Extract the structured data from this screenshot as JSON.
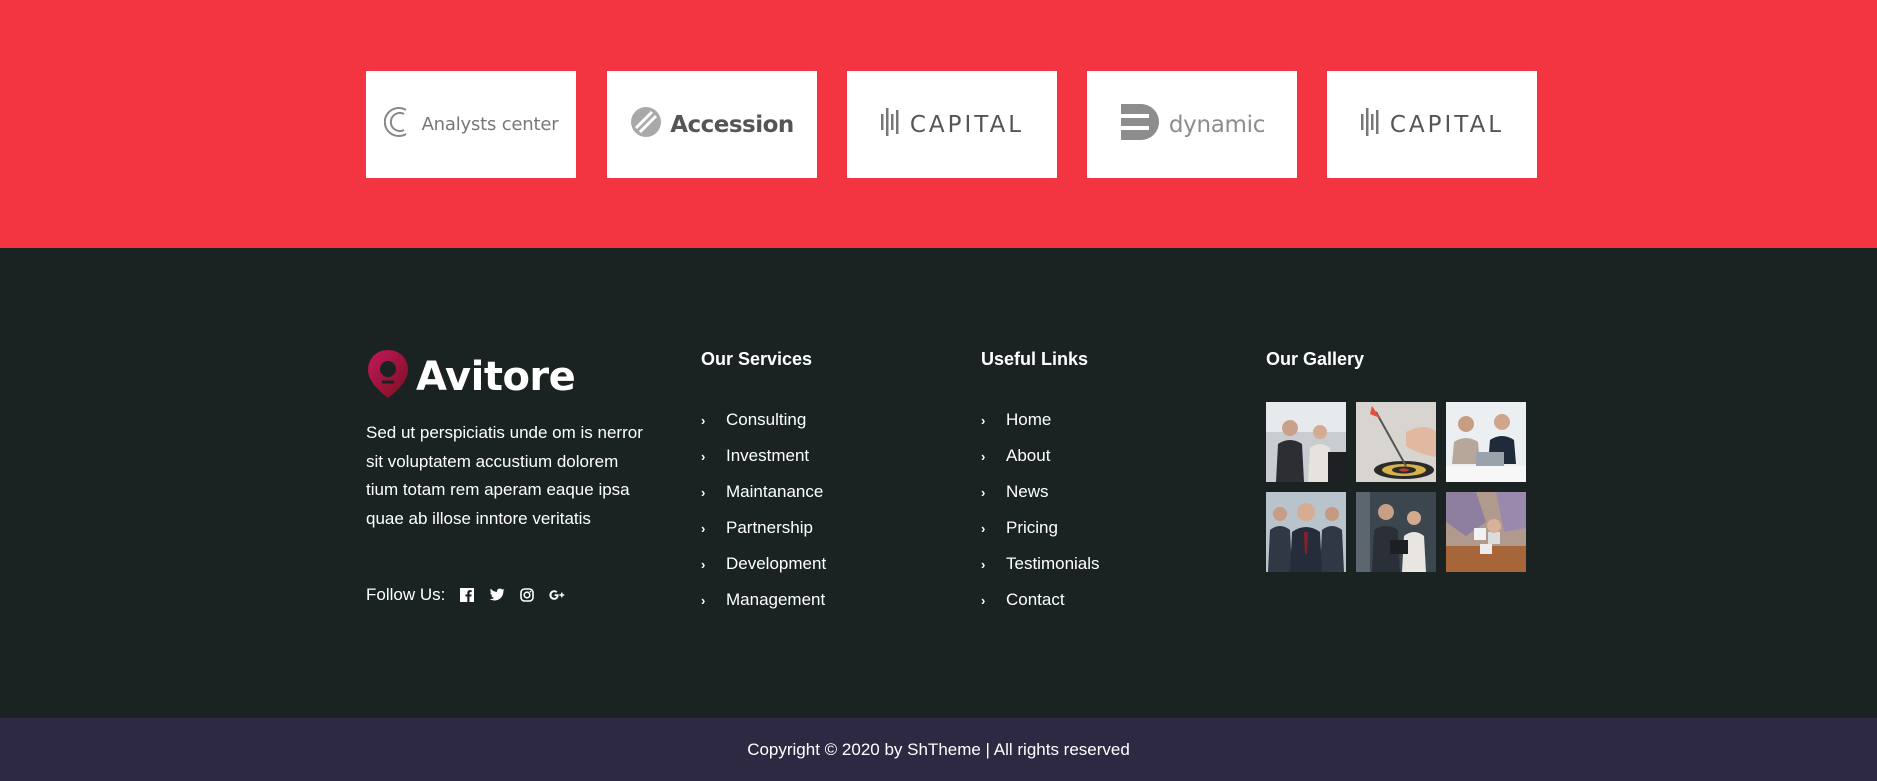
{
  "partners": [
    {
      "name": "Analysts center",
      "icon": "analysts-center-logo-icon"
    },
    {
      "name": "Accession",
      "icon": "accession-logo-icon"
    },
    {
      "name": "CAPITAL",
      "icon": "capital-logo-icon"
    },
    {
      "name": "dynamic",
      "icon": "dynamic-logo-icon"
    },
    {
      "name": "CAPITAL",
      "icon": "capital-logo-icon"
    }
  ],
  "brand": {
    "name": "Avitore",
    "icon": "map-pin-logo-icon",
    "gradient": [
      "#c2185b",
      "#7b1020"
    ]
  },
  "about": {
    "text": "Sed ut perspiciatis unde om is nerror sit voluptatem accustium dolorem tium totam rem aperam eaque ipsa quae ab illose inntore veritatis"
  },
  "follow": {
    "label": "Follow Us:",
    "icons": [
      "facebook-icon",
      "twitter-icon",
      "instagram-icon",
      "google-plus-icon"
    ]
  },
  "services": {
    "title": "Our Services",
    "items": [
      "Consulting",
      "Investment",
      "Maintanance",
      "Partnership",
      "Development",
      "Management"
    ]
  },
  "useful_links": {
    "title": "Useful Links",
    "items": [
      "Home",
      "About",
      "News",
      "Pricing",
      "Testimonials",
      "Contact"
    ]
  },
  "gallery": {
    "title": "Our Gallery",
    "images": [
      "business-people-photo",
      "dart-target-photo",
      "team-laptop-photo",
      "business-team-photo",
      "colleagues-photo",
      "puzzle-hands-photo"
    ]
  },
  "copyright": "Copyright © 2020 by ShTheme | All rights reserved",
  "colors": {
    "accent": "#f33541",
    "footer_bg": "#1a2222",
    "copyright_bg": "#2e2943",
    "text": "#ffffff"
  }
}
